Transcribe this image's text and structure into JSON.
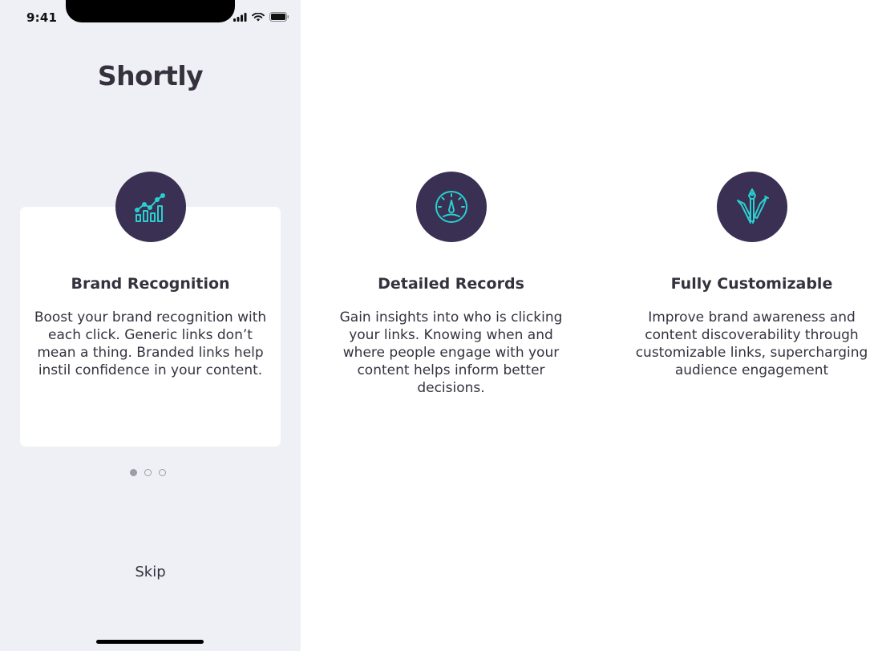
{
  "status_bar": {
    "time": "9:41"
  },
  "app": {
    "logo": "Shortly"
  },
  "slides": [
    {
      "icon": "chart-icon",
      "title": "Brand Recognition",
      "text": "Boost your brand recognition with each click. Generic links don’t mean a thing. Branded links help instil confidence in your content."
    },
    {
      "icon": "speedometer-icon",
      "title": "Detailed Records",
      "text": "Gain insights into who is clicking your links. Knowing when and where people engage with your content helps inform better decisions."
    },
    {
      "icon": "pens-icon",
      "title": "Fully Customizable",
      "text": "Improve brand awareness and content discoverability through customizable links, supercharging audience engagement"
    }
  ],
  "pagination": {
    "total": 3,
    "active": 0
  },
  "skip_label": "Skip",
  "colors": {
    "icon_bg": "#3a3054",
    "accent": "#2acfcf",
    "phone_bg": "#eff0f6",
    "text": "#35323e"
  }
}
